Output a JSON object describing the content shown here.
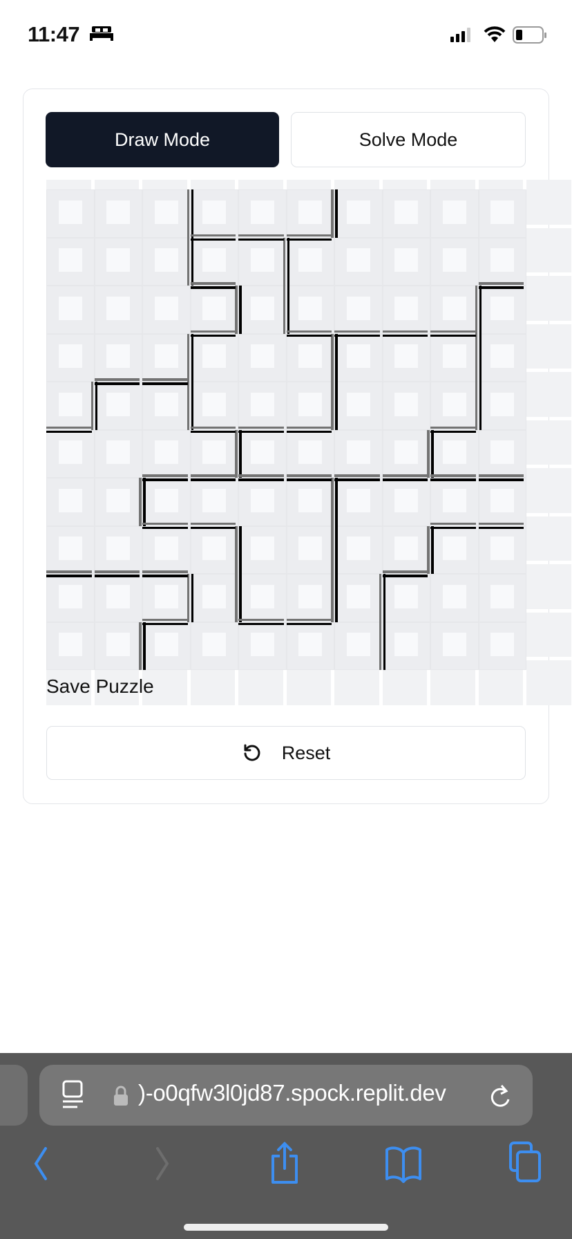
{
  "status_bar": {
    "time": "11:47",
    "sleep_icon": "bed-icon"
  },
  "modes": {
    "draw_label": "Draw Mode",
    "solve_label": "Solve Mode",
    "active": "draw"
  },
  "puzzle": {
    "rows": 10,
    "cols": 10,
    "vertical_walls_by_row": [
      [
        3,
        6
      ],
      [
        3,
        5
      ],
      [
        4,
        5,
        9
      ],
      [
        3,
        6,
        9
      ],
      [
        1,
        3,
        6,
        9
      ],
      [
        4,
        8
      ],
      [
        2,
        6
      ],
      [
        4,
        6,
        8
      ],
      [
        3,
        4,
        6,
        7
      ],
      [
        2,
        7
      ]
    ],
    "horizontal_walls_by_line": {
      "1": [
        3,
        4,
        5
      ],
      "2": [
        3,
        9
      ],
      "3": [
        3,
        5,
        6,
        7,
        8
      ],
      "4": [
        1,
        2
      ],
      "5": [
        0,
        3,
        4,
        5,
        8
      ],
      "6": [
        2,
        3,
        4,
        5,
        6,
        7,
        8,
        9
      ],
      "7": [
        2,
        3,
        8,
        9
      ],
      "8": [
        0,
        1,
        2,
        7
      ],
      "9": [
        2,
        4,
        5
      ]
    }
  },
  "save_label": "Save Puzzle",
  "reset_label": "Reset",
  "browser": {
    "url": ")-o0qfw3l0jd87.spock.replit.dev",
    "accent": "#3d8ef0"
  }
}
